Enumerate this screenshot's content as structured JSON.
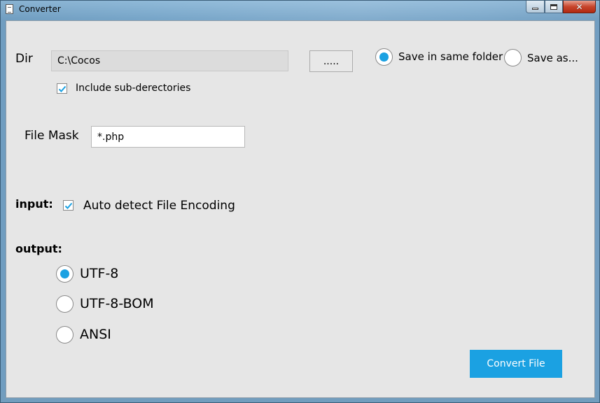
{
  "window": {
    "title": "Converter"
  },
  "dir": {
    "label": "Dir",
    "value": "C:\\Cocos",
    "browse_label": ".....",
    "include_subdirs_label": "Include sub-derectories",
    "include_subdirs_checked": true
  },
  "save": {
    "same_folder_label": "Save in same folder",
    "save_as_label": "Save as...",
    "selected": "same_folder"
  },
  "mask": {
    "label": "File Mask",
    "value": "*.php"
  },
  "input": {
    "heading": "input:",
    "auto_detect_label": "Auto detect File Encoding",
    "auto_detect_checked": true
  },
  "output": {
    "heading": "output:",
    "options": [
      "UTF-8",
      "UTF-8-BOM",
      "ANSI"
    ],
    "selected": "UTF-8"
  },
  "convert_label": "Convert File",
  "colors": {
    "accent": "#1ba1e2",
    "client_bg": "#e6e6e6"
  }
}
